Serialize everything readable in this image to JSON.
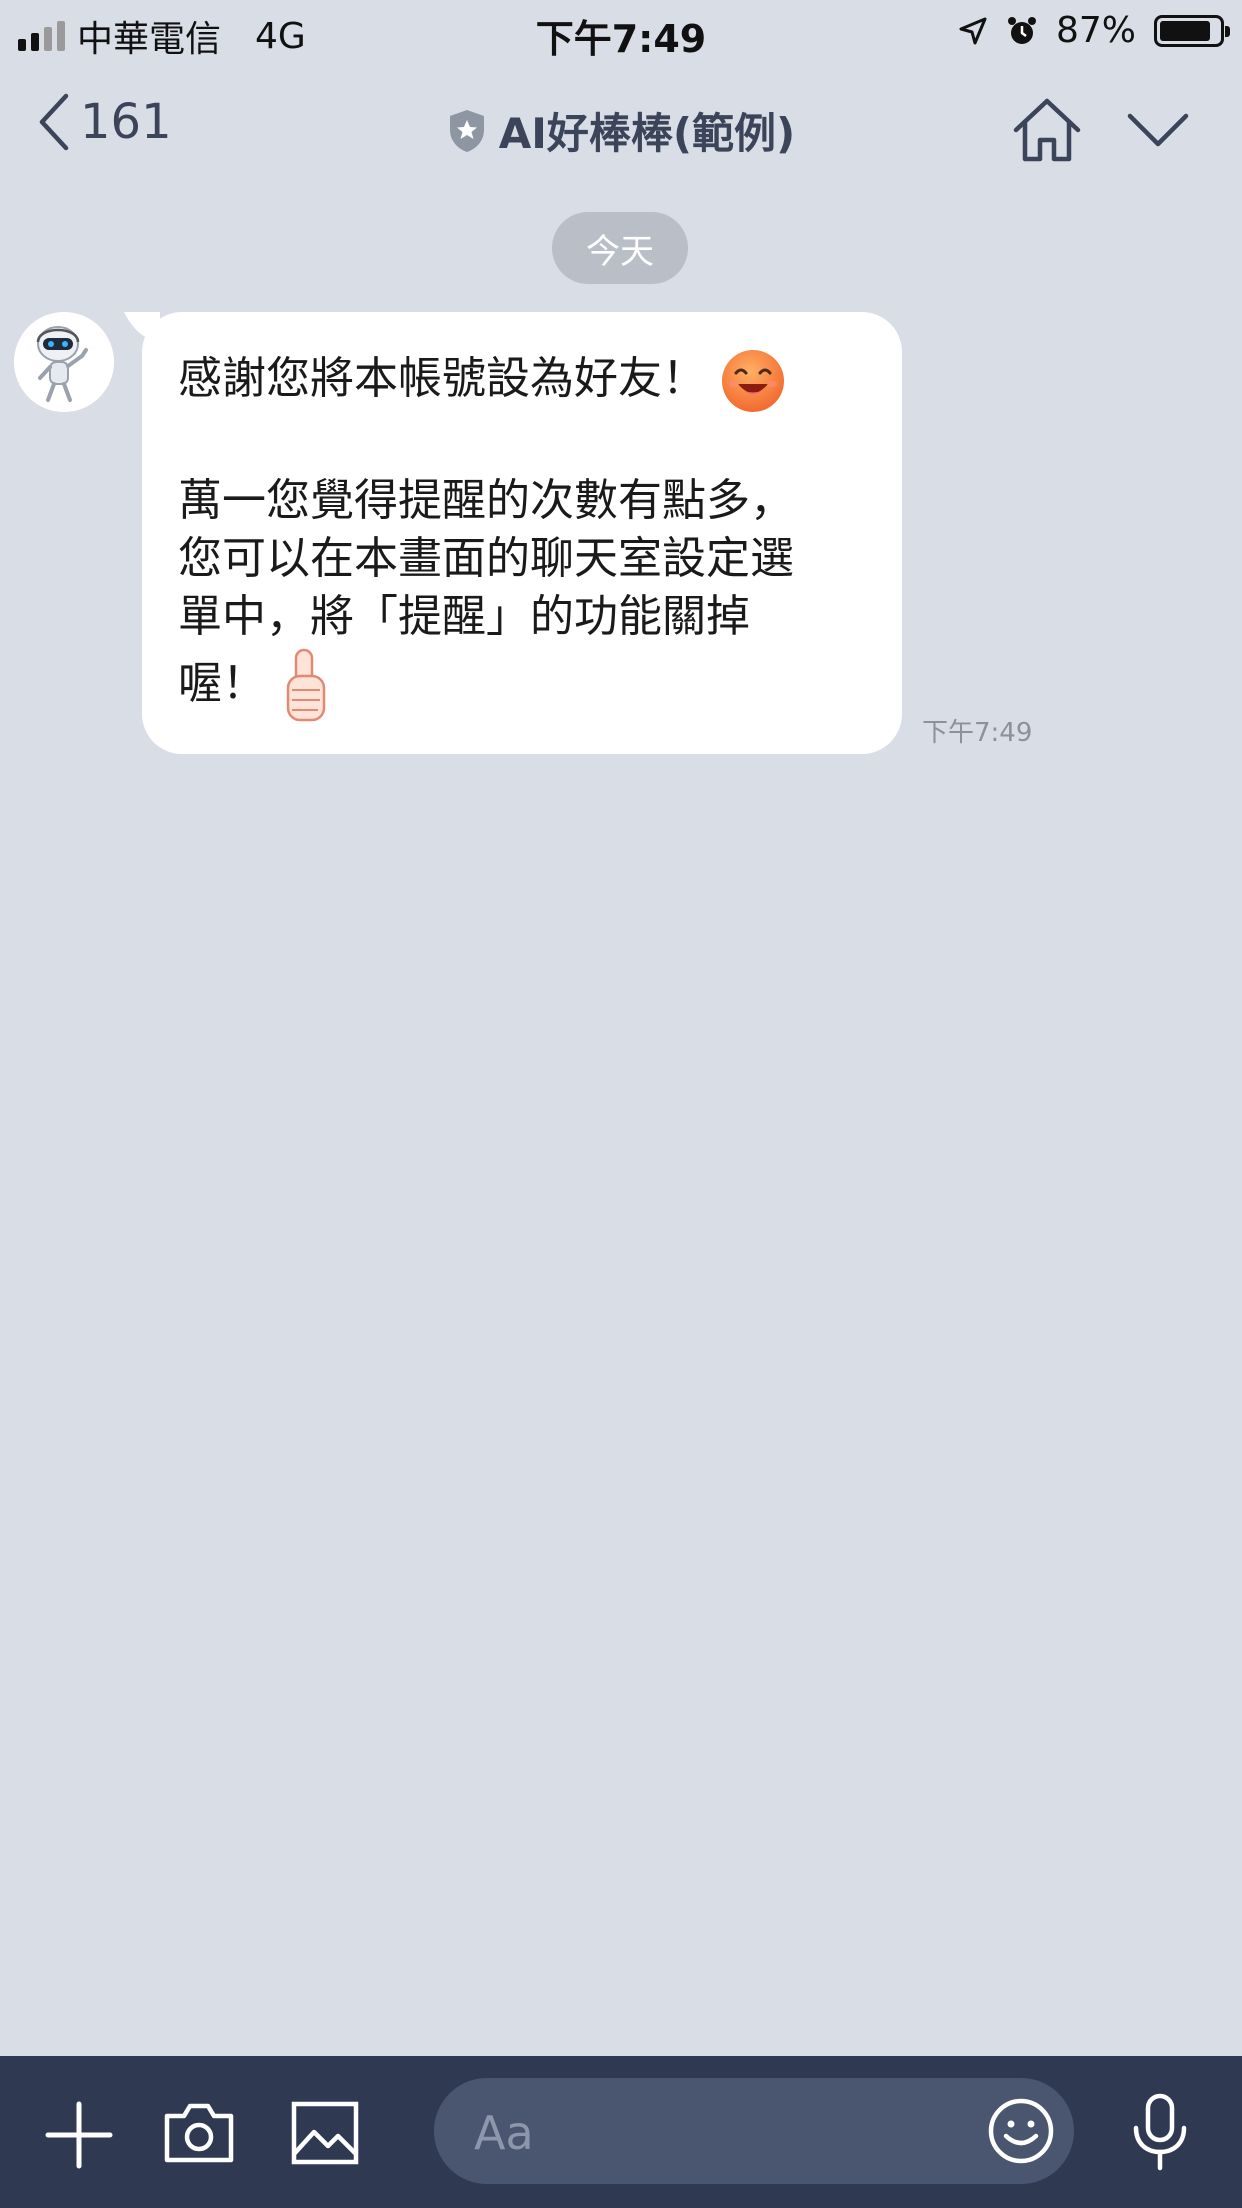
{
  "status_bar": {
    "carrier": "中華電信",
    "network": "4G",
    "time": "下午7:49",
    "battery": "87%",
    "battery_level": 0.87
  },
  "header": {
    "back_count": "161",
    "title": "AI好棒棒(範例)"
  },
  "chat": {
    "date_label": "今天",
    "messages": [
      {
        "line1": "感謝您將本帳號設為好友！",
        "line2": "萬一您覺得提醒的次數有點多，",
        "line3": "您可以在本畫面的聊天室設定選",
        "line4": "單中，將「提醒」的功能關掉",
        "line5": "喔！",
        "time": "下午7:49"
      }
    ]
  },
  "input": {
    "placeholder": "Aa"
  },
  "colors": {
    "background": "#d8dde6",
    "bottom_bar": "#2f3a52",
    "header_text": "#3b4458"
  }
}
